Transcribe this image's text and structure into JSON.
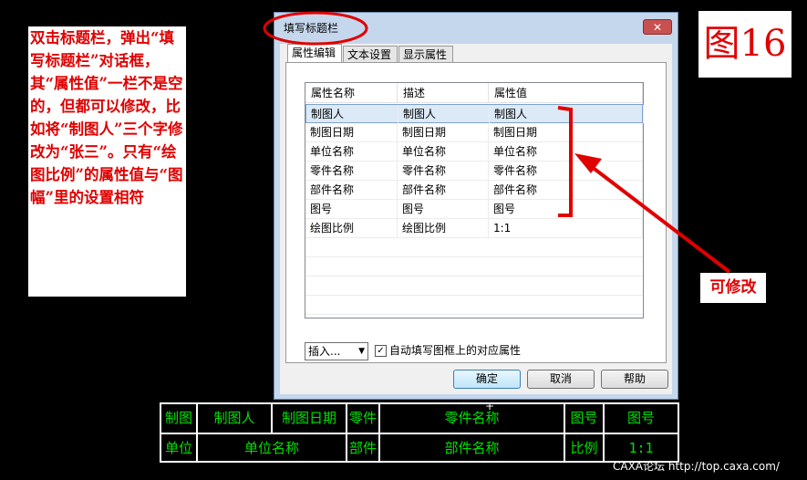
{
  "note_text": "双击标题栏，弹出“填写标题栏”对话框，其“属性值”一栏不是空的，但都可以修改，比如将“制图人”三个字修改为“张三”。只有“绘图比例”的属性值与“图幅”里的设置相符",
  "figure_label": "图16",
  "modify_label": "可修改",
  "dialog": {
    "title": "填写标题栏",
    "close_glyph": "✕",
    "tabs": [
      "属性编辑",
      "文本设置",
      "显示属性"
    ],
    "grid": {
      "columns": [
        "属性名称",
        "描述",
        "属性值"
      ],
      "rows": [
        [
          "制图人",
          "制图人",
          "制图人"
        ],
        [
          "制图日期",
          "制图日期",
          "制图日期"
        ],
        [
          "单位名称",
          "单位名称",
          "单位名称"
        ],
        [
          "零件名称",
          "零件名称",
          "零件名称"
        ],
        [
          "部件名称",
          "部件名称",
          "部件名称"
        ],
        [
          "图号",
          "图号",
          "图号"
        ],
        [
          "绘图比例",
          "绘图比例",
          "1:1"
        ]
      ]
    },
    "insert_label": "插入...",
    "auto_fill_label": "自动填写图框上的对应属性",
    "auto_fill_checked": "✓",
    "ok_label": "确定",
    "cancel_label": "取消",
    "help_label": "帮助"
  },
  "title_block": {
    "row1": [
      "制图",
      "制图人",
      "制图日期",
      "零件",
      "零件名称",
      "图号",
      "图号"
    ],
    "row2": [
      "单位",
      "单位名称",
      "部件",
      "部件名称",
      "比例",
      "1:1"
    ]
  },
  "watermark": "CAXA论坛 http://top.caxa.com/",
  "colors": {
    "annotation_red": "#e00000",
    "title_block_green": "#00e000"
  }
}
